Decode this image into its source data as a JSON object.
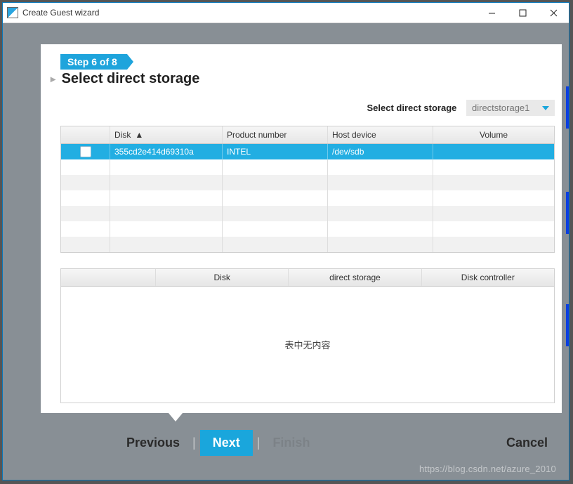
{
  "window": {
    "title": "Create Guest wizard"
  },
  "step": {
    "badge": "Step 6 of 8",
    "heading": "Select direct storage"
  },
  "selector": {
    "label": "Select direct storage",
    "value": "directstorage1"
  },
  "table1": {
    "headers": {
      "chk": "",
      "disk": "Disk",
      "product": "Product number",
      "host": "Host device",
      "volume": "Volume"
    },
    "rows": [
      {
        "disk": "355cd2e414d69310a",
        "product": "INTEL",
        "host": "/dev/sdb",
        "volume": ""
      }
    ]
  },
  "table2": {
    "headers": {
      "blank": "",
      "disk": "Disk",
      "storage": "direct storage",
      "controller": "Disk controller"
    },
    "empty_text": "表中无内容"
  },
  "footer": {
    "previous": "Previous",
    "next": "Next",
    "finish": "Finish",
    "cancel": "Cancel"
  },
  "watermark": "https://blog.csdn.net/azure_2010"
}
